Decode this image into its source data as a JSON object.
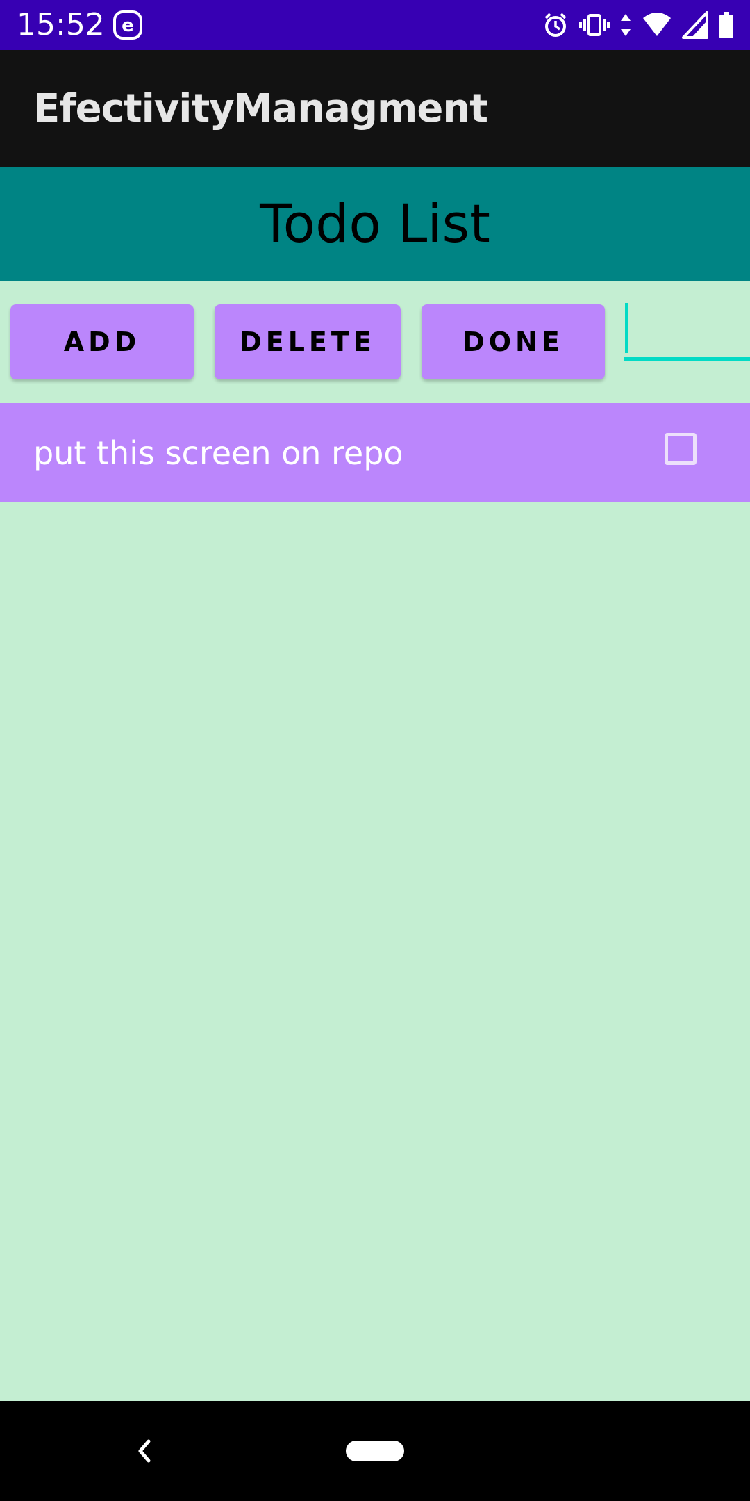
{
  "status_bar": {
    "time": "15:52",
    "app_icon": "e-notification-icon",
    "icons": [
      "alarm-icon",
      "vibrate-icon",
      "data-arrows-icon",
      "wifi-icon",
      "cell-signal-icon",
      "battery-icon"
    ],
    "background": "#3700b3"
  },
  "app_bar": {
    "title": "EfectivityManagment",
    "background": "#121212"
  },
  "header": {
    "title": "Todo List",
    "background": "#008484"
  },
  "toolbar": {
    "add_label": "ADD",
    "delete_label": "DELETE",
    "done_label": "DONE",
    "button_color": "#bb86fc",
    "input": {
      "value": "",
      "placeholder": "",
      "accent": "#03dac5"
    }
  },
  "todos": [
    {
      "text": "put this screen on repo",
      "checked": false
    }
  ],
  "page": {
    "background": "#c4eed2"
  },
  "nav_bar": {
    "back_icon": "back-chevron-icon",
    "home_icon": "home-pill-icon"
  }
}
